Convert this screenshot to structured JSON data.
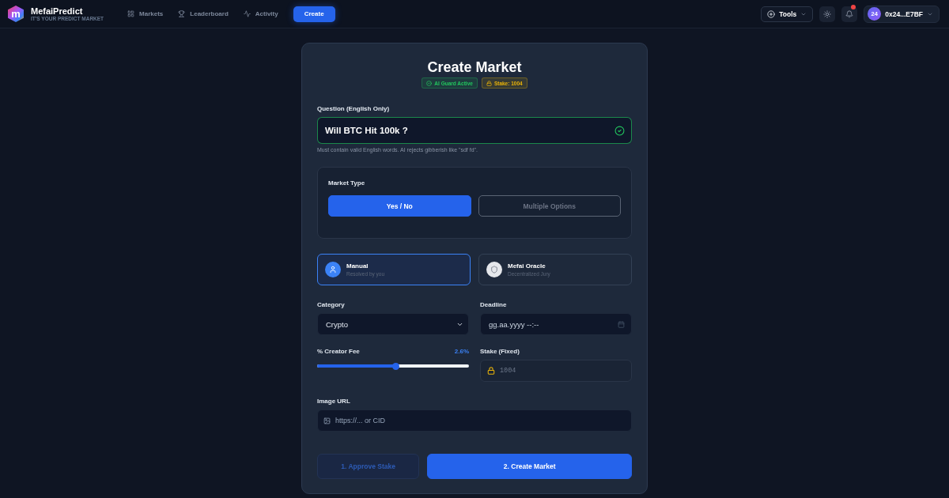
{
  "header": {
    "logo": {
      "mark": "m",
      "name": "MefaiPredict",
      "tagline": "IT'S YOUR PREDICT MARKET"
    },
    "nav": [
      {
        "label": "Markets",
        "selected": false
      },
      {
        "label": "Leaderboard",
        "selected": false
      },
      {
        "label": "Activity",
        "selected": false
      },
      {
        "label": "Create",
        "selected": true
      }
    ],
    "tools": {
      "label": "Tools"
    },
    "notifications": {
      "unread": true
    },
    "wallet": {
      "avatar": "24",
      "address": "0x24...E7BF"
    }
  },
  "form": {
    "title": "Create Market",
    "badges": [
      {
        "kind": "guard",
        "label": "AI Guard Active"
      },
      {
        "kind": "stake",
        "label": "Stake: 1004"
      }
    ],
    "question": {
      "label": "Question (English Only)",
      "value": "Will BTC Hit 100k ?",
      "valid": true,
      "hint": "Must contain valid English words. AI rejects gibberish like \"sdf fd\"."
    },
    "market_type": {
      "label": "Market Type",
      "options": [
        {
          "label": "Yes / No",
          "selected": true
        },
        {
          "label": "Multiple Options",
          "selected": false
        }
      ]
    },
    "resolvers": [
      {
        "kind": "manual",
        "title": "Manual",
        "subtitle": "Resolved by you",
        "selected": true
      },
      {
        "kind": "oracle",
        "title": "Mefai Oracle",
        "subtitle": "Decentralized Jury",
        "selected": false
      }
    ],
    "category": {
      "label": "Category",
      "value": "Crypto"
    },
    "deadline": {
      "label": "Deadline",
      "placeholder": "gg.aa.yyyy --:--"
    },
    "creator_fee": {
      "label": "% Creator Fee",
      "reading": "2.6%",
      "level": 0.52
    },
    "stake": {
      "label": "Stake (Fixed)",
      "value": "1004"
    },
    "image_url": {
      "label": "Image URL",
      "placeholder": "https://... or CID"
    },
    "actions": [
      {
        "kind": "secondary",
        "label": "1. Approve Stake"
      },
      {
        "kind": "primary",
        "label": "2. Create Market"
      }
    ]
  }
}
